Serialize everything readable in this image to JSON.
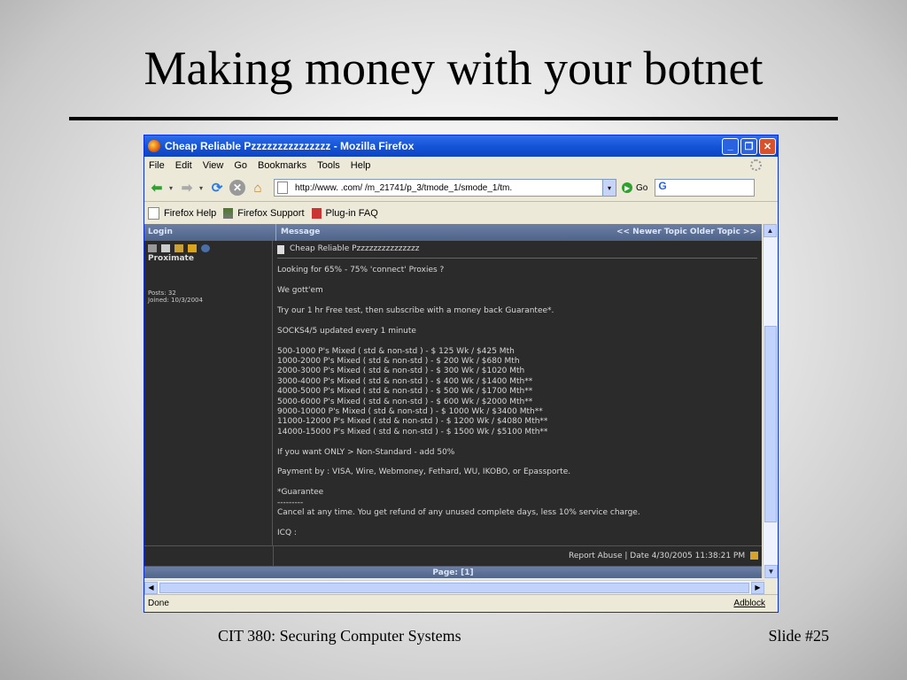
{
  "slide": {
    "title": "Making money with your botnet",
    "footer_left": "CIT 380: Securing Computer Systems",
    "footer_right": "Slide #25"
  },
  "browser": {
    "window_title": "Cheap Reliable Pzzzzzzzzzzzzzzz - Mozilla Firefox",
    "menu": [
      "File",
      "Edit",
      "View",
      "Go",
      "Bookmarks",
      "Tools",
      "Help"
    ],
    "url": "http://www.              .com/          /m_21741/p_3/tmode_1/smode_1/tm.",
    "go_label": "Go",
    "search_engine_glyph": "G",
    "bookmarks": [
      "Firefox Help",
      "Firefox Support",
      "Plug-in FAQ"
    ],
    "status_left": "Done",
    "status_right": "Adblock"
  },
  "forum": {
    "header_login": "Login",
    "header_message": "Message",
    "header_nav": "<< Newer Topic  Older Topic >>",
    "username": "Proximate",
    "posts": "Posts: 32",
    "joined": "Joined: 10/3/2004",
    "subject": "Cheap Reliable Pzzzzzzzzzzzzzzz",
    "lines": [
      "Looking for 65% - 75% 'connect' Proxies ?",
      "We gott'em",
      "Try our 1 hr Free test, then subscribe with a money back Guarantee*.",
      "SOCKS4/5 updated every 1 minute",
      "500-1000 P's Mixed ( std & non-std ) - $ 125 Wk / $425 Mth\n1000-2000 P's Mixed ( std & non-std ) - $ 200 Wk / $680 Mth\n2000-3000 P's Mixed ( std & non-std ) - $ 300 Wk / $1020 Mth\n3000-4000 P's Mixed ( std & non-std ) - $ 400 Wk / $1400 Mth**\n4000-5000 P's Mixed ( std & non-std ) - $ 500 Wk / $1700 Mth**\n5000-6000 P's Mixed ( std & non-std ) - $ 600 Wk / $2000 Mth**\n9000-10000 P's Mixed ( std & non-std ) - $ 1000 Wk / $3400 Mth**\n11000-12000 P's Mixed ( std & non-std ) - $ 1200 Wk / $4080 Mth**\n14000-15000 P's Mixed ( std & non-std ) - $ 1500 Wk / $5100 Mth**",
      "If you want ONLY > Non-Standard - add 50%",
      "Payment by : VISA, Wire, Webmoney, Fethard, WU, IKOBO, or Epassporte.",
      "*Guarantee\n---------\nCancel at any time. You get refund of any unused complete days, less 10% service charge.",
      "ICQ :"
    ],
    "report_abuse": "Report Abuse",
    "date": "Date 4/30/2005 11:38:21 PM",
    "pager": "Page:  [1]"
  }
}
